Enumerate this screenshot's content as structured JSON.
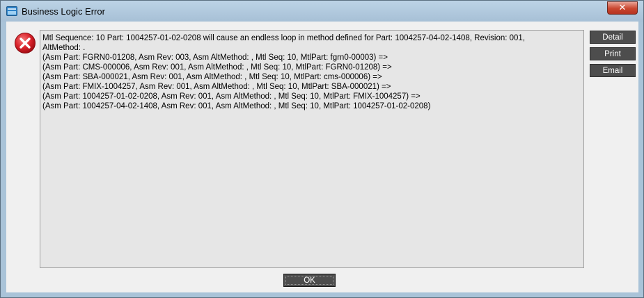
{
  "window": {
    "title": "Business Logic Error",
    "close_glyph": "✕"
  },
  "message": {
    "lines": [
      "Mtl Sequence: 10 Part: 1004257-01-02-0208 will cause an endless loop in method defined for Part: 1004257-04-02-1408, Revision: 001,",
      "AltMethod: .",
      "(Asm Part: FGRN0-01208, Asm Rev: 003,  Asm AltMethod: , Mtl Seq: 10, MtlPart: fgrn0-00003) =>",
      "(Asm Part: CMS-000006, Asm Rev: 001,  Asm AltMethod: , Mtl Seq: 10, MtlPart: FGRN0-01208) =>",
      "(Asm Part: SBA-000021, Asm Rev: 001,  Asm AltMethod: , Mtl Seq: 10, MtlPart: cms-000006) =>",
      "(Asm Part: FMIX-1004257, Asm Rev: 001,  Asm AltMethod: , Mtl Seq: 10, MtlPart: SBA-000021) =>",
      "(Asm Part: 1004257-01-02-0208, Asm Rev: 001,  Asm AltMethod: , Mtl Seq: 10, MtlPart: FMIX-1004257) =>",
      "(Asm Part: 1004257-04-02-1408, Asm Rev: 001,  Asm AltMethod: , Mtl Seq: 10, MtlPart: 1004257-01-02-0208)"
    ]
  },
  "buttons": {
    "detail": "Detail",
    "print": "Print",
    "email": "Email",
    "ok": "OK"
  },
  "icons": {
    "title": "window-app-icon",
    "error": "error-x-icon",
    "close": "close-icon"
  },
  "colors": {
    "error_red": "#d9232b",
    "close_red": "#c9462f",
    "button_dark": "#4d4d4d"
  }
}
